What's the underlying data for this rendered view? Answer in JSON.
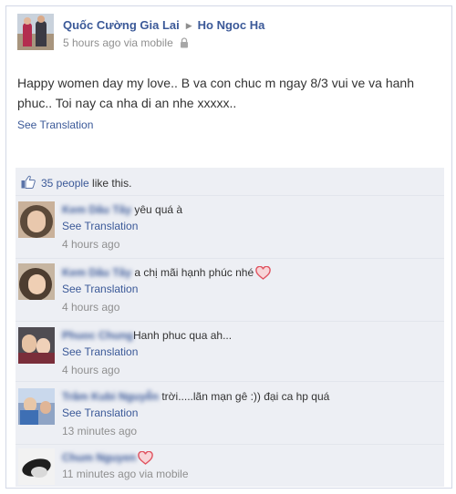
{
  "post": {
    "author": "Quốc Cường Gia Lai",
    "target": "Ho Ngoc Ha",
    "meta": "5 hours ago via mobile",
    "message": "Happy women day my love.. B va con chuc m ngay 8/3 vui ve va hanh phuc.. Toi nay ca nha di an nhe xxxxx..",
    "see_translation": "See Translation"
  },
  "likes": {
    "count_link": "35 people",
    "suffix": " like this."
  },
  "comments": [
    {
      "author": "Kem Dâu Tây",
      "text": " yêu quá à",
      "translation": "See Translation",
      "time": "4 hours ago"
    },
    {
      "author": "Kem Dâu Tây",
      "text": " a chị mãi hạnh phúc nhé",
      "translation": "See Translation",
      "time": "4 hours ago"
    },
    {
      "author": "Phuoc Chung",
      "text": "Hanh phuc qua ah...",
      "translation": "See Translation",
      "time": "4 hours ago"
    },
    {
      "author": "Trâm Kubi Nguyễn",
      "text": " trời.....lãn mạn gê :)) đại ca hp quá",
      "translation": "See Translation",
      "time": "13 minutes ago"
    },
    {
      "author": "Chum Nguyen",
      "text": "",
      "time": "11 minutes ago via mobile"
    }
  ],
  "colors": {
    "link": "#3b5998",
    "meta": "#8f8f8f",
    "feedback_bg": "#edeff4",
    "heart": "#e0525f"
  },
  "icons": [
    "lock-icon",
    "thumbs-up-icon",
    "heart-icon",
    "arrow-right-icon"
  ]
}
